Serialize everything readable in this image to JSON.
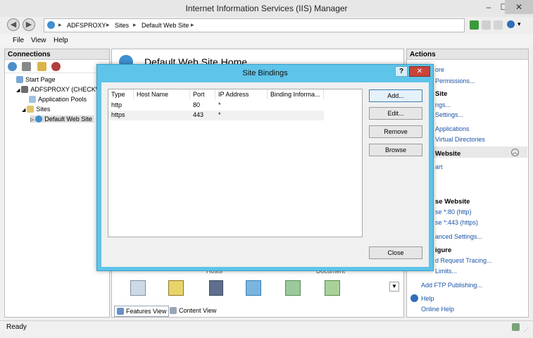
{
  "window": {
    "title": "Internet Information Services (IIS) Manager",
    "min": "–",
    "max": "☐",
    "close": "✕"
  },
  "address": {
    "crumbs": [
      "ADFSPROXY",
      "Sites",
      "Default Web Site"
    ],
    "sep": "▸"
  },
  "menu": [
    "File",
    "View",
    "Help"
  ],
  "connections": {
    "title": "Connections",
    "tree": [
      "Start Page",
      "ADFSPROXY (CHECKWHA",
      "Application Pools",
      "Sites",
      "Default Web Site"
    ]
  },
  "center": {
    "title": "Default Web Site Home",
    "group_labels": [
      "Hosts",
      "Document"
    ],
    "tabs": {
      "features": "Features View",
      "content": "Content View"
    }
  },
  "actions": {
    "title": "Actions",
    "items": [
      {
        "text": "ore",
        "kind": "link"
      },
      {
        "text": "Permissions...",
        "kind": "link"
      },
      {
        "text": "Site",
        "kind": "head"
      },
      {
        "text": "ngs...",
        "kind": "link"
      },
      {
        "text": "Settings...",
        "kind": "link"
      },
      {
        "text": "Applications",
        "kind": "link"
      },
      {
        "text": "Virtual Directories",
        "kind": "link"
      },
      {
        "text": "Website",
        "kind": "head"
      },
      {
        "text": "art",
        "kind": "link"
      },
      {
        "text": "se Website",
        "kind": "head"
      },
      {
        "text": "se *:80 (http)",
        "kind": "link"
      },
      {
        "text": "se *:443 (https)",
        "kind": "link"
      },
      {
        "text": "anced Settings...",
        "kind": "link"
      },
      {
        "text": "igure",
        "kind": "head"
      },
      {
        "text": "d Request Tracing...",
        "kind": "link"
      },
      {
        "text": "Limits...",
        "kind": "link"
      },
      {
        "text": "Add FTP Publishing...",
        "kind": "link"
      },
      {
        "text": "Help",
        "kind": "link"
      },
      {
        "text": "Online Help",
        "kind": "link"
      }
    ]
  },
  "dialog": {
    "title": "Site Bindings",
    "help": "?",
    "close": "✕",
    "columns": [
      "Type",
      "Host Name",
      "Port",
      "IP Address",
      "Binding Informa..."
    ],
    "rows": [
      [
        "http",
        "",
        "80",
        "*",
        ""
      ],
      [
        "https",
        "",
        "443",
        "*",
        ""
      ]
    ],
    "buttons": {
      "add": "Add...",
      "edit": "Edit...",
      "remove": "Remove",
      "browse": "Browse",
      "close": "Close"
    }
  },
  "status": {
    "text": "Ready"
  },
  "colors": {
    "dialog_frame": "#5ec4ea",
    "link": "#1a54a8",
    "close_red": "#c9443a"
  }
}
